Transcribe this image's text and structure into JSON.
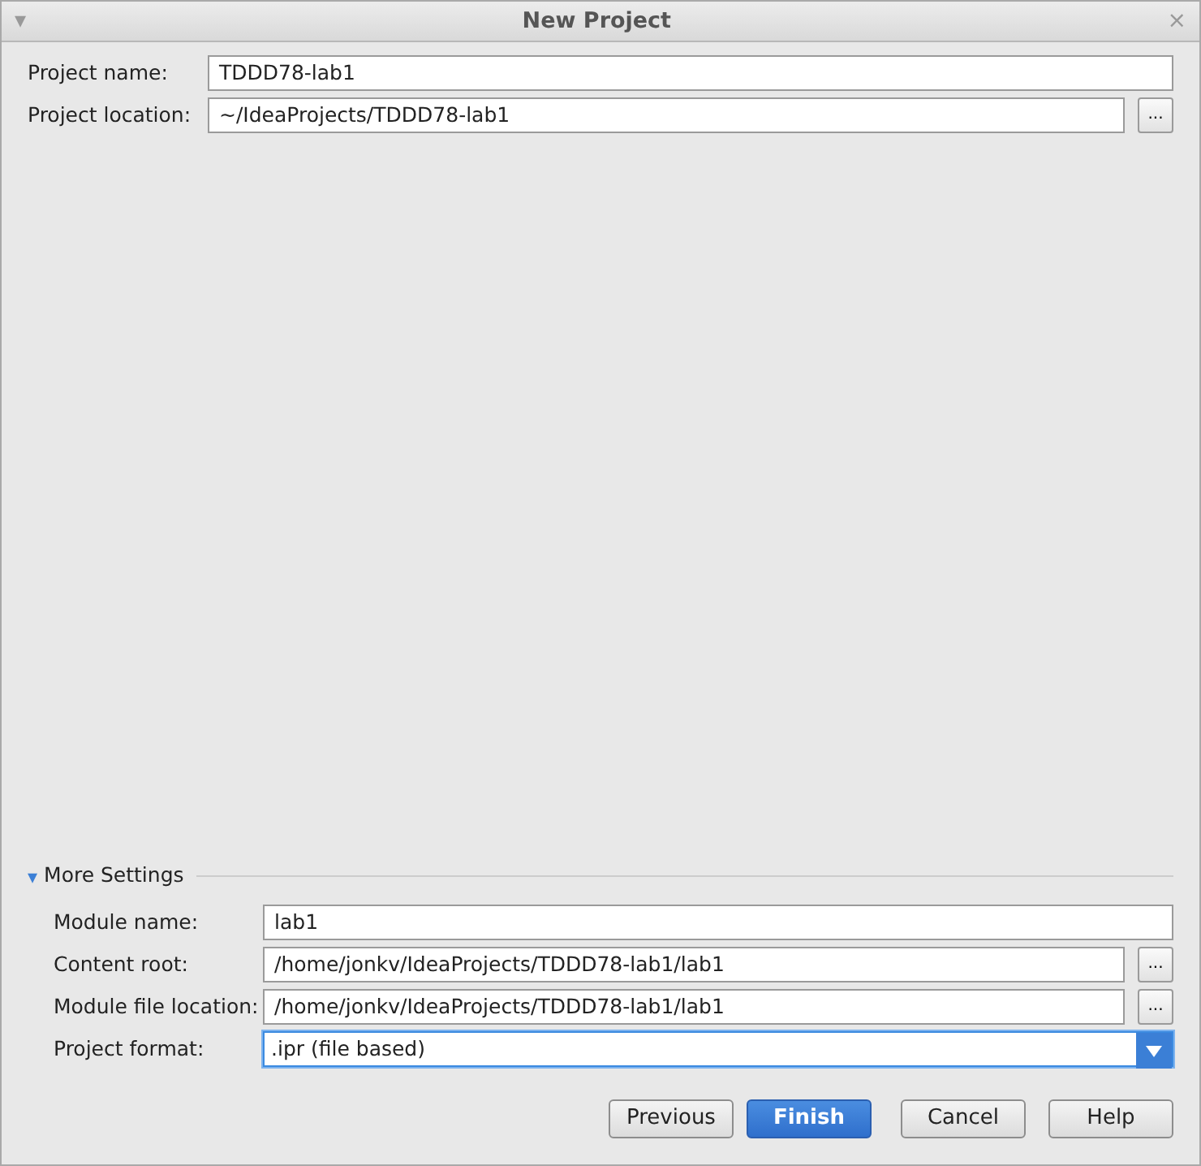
{
  "window": {
    "title": "New Project",
    "menu_glyph": "▾",
    "close_glyph": "×"
  },
  "project_fields": [
    {
      "label": "Project name:",
      "kind": "text",
      "value": "TDDD78-lab1",
      "focused": false
    },
    {
      "label": "Project location:",
      "kind": "browse",
      "value": "~/IdeaProjects/TDDD78-lab1",
      "button": "...",
      "focused": false
    }
  ],
  "more_settings": {
    "label": "More Settings",
    "expanded": true,
    "glyph": "▾",
    "fields": [
      {
        "label": "Module name:",
        "kind": "text",
        "value": "lab1",
        "focused": false
      },
      {
        "label": "Content root:",
        "kind": "browse",
        "value": "/home/jonkv/IdeaProjects/TDDD78-lab1/lab1",
        "button": "...",
        "focused": false
      },
      {
        "label": "Module file location:",
        "kind": "browse",
        "value": "/home/jonkv/IdeaProjects/TDDD78-lab1/lab1",
        "button": "...",
        "focused": false
      },
      {
        "label": "Project format:",
        "kind": "dropdown",
        "value": ".ipr (file based)",
        "focused": true
      }
    ]
  },
  "buttons": [
    {
      "label": "Previous",
      "kind": "default"
    },
    {
      "label": "Finish",
      "kind": "primary"
    },
    {
      "label": "Cancel",
      "kind": "default"
    },
    {
      "label": "Help",
      "kind": "default"
    }
  ]
}
